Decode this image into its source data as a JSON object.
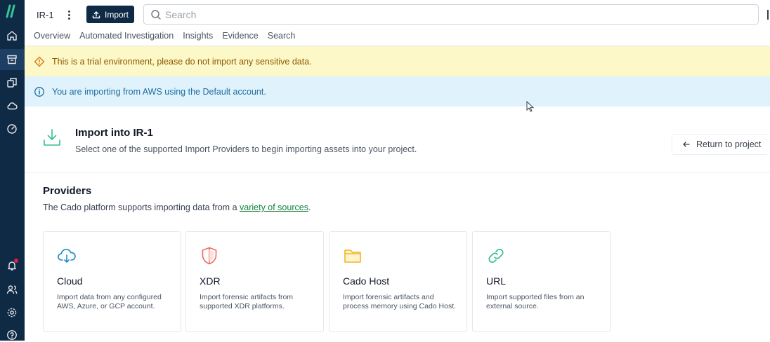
{
  "header": {
    "project_name": "IR-1",
    "import_label": "Import",
    "search_placeholder": "Search"
  },
  "tabs": [
    "Overview",
    "Automated Investigation",
    "Insights",
    "Evidence",
    "Search"
  ],
  "banners": {
    "warning": "This is a trial environment, please do not import any sensitive data.",
    "info": "You are importing from AWS using the Default account."
  },
  "import_header": {
    "title": "Import into IR-1",
    "subtitle": "Select one of the supported Import Providers to begin importing assets into your project.",
    "return_label": "Return to project"
  },
  "providers": {
    "title": "Providers",
    "subtitle_before": "The Cado platform supports importing data from a ",
    "subtitle_link": "variety of sources",
    "subtitle_after": ".",
    "items": [
      {
        "title": "Cloud",
        "description": "Import data from any configured AWS, Azure, or GCP account.",
        "icon": "cloud-download-icon"
      },
      {
        "title": "XDR",
        "description": "Import forensic artifacts from supported XDR platforms.",
        "icon": "shield-icon"
      },
      {
        "title": "Cado Host",
        "description": "Import forensic artifacts and process memory using Cado Host.",
        "icon": "folder-icon"
      },
      {
        "title": "URL",
        "description": "Import supported files from an external source.",
        "icon": "link-icon"
      }
    ]
  },
  "colors": {
    "sidebar": "#0f2a45",
    "warning_bg": "#fdf8c8",
    "info_bg": "#e0f2fb",
    "link": "#15803d"
  }
}
